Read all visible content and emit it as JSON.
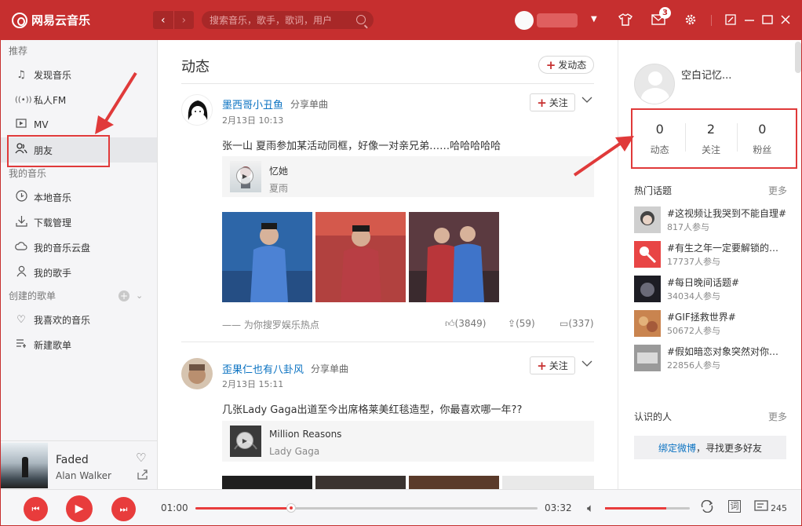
{
  "titlebar": {
    "app_name": "网易云音乐",
    "back_icon": "chevron-left",
    "forward_icon": "chevron-right",
    "search_placeholder": "搜索音乐，歌手，歌词，用户",
    "mail_badge": "3"
  },
  "sidebar": {
    "section_recommend": "推荐",
    "recommend_items": [
      {
        "icon": "music-note-icon",
        "label": "发现音乐"
      },
      {
        "icon": "radio-icon",
        "label": "私人FM"
      },
      {
        "icon": "mv-icon",
        "label": "MV"
      },
      {
        "icon": "friends-icon",
        "label": "朋友"
      }
    ],
    "section_my_music": "我的音乐",
    "my_music_items": [
      {
        "icon": "local-music-icon",
        "label": "本地音乐"
      },
      {
        "icon": "download-icon",
        "label": "下载管理"
      },
      {
        "icon": "cloud-icon",
        "label": "我的音乐云盘"
      },
      {
        "icon": "singer-icon",
        "label": "我的歌手"
      }
    ],
    "section_playlists": "创建的歌单",
    "playlist_items": [
      {
        "icon": "heart-icon",
        "label": "我喜欢的音乐"
      },
      {
        "icon": "new-playlist-icon",
        "label": "新建歌单"
      }
    ]
  },
  "now_playing": {
    "title": "Faded",
    "artist": "Alan Walker"
  },
  "player": {
    "current_time": "01:00",
    "total_time": "03:32",
    "progress": 0.28,
    "volume": 0.72,
    "lyrics_label": "词",
    "playlist_count": "245"
  },
  "main": {
    "title": "动态",
    "post_button": "发动态",
    "posts": [
      {
        "user": "墨西哥小丑鱼",
        "action": "分享单曲",
        "date": "2月13日 10:13",
        "follow": "关注",
        "text": "张一山 夏雨参加某活动同框，好像一对亲兄弟……哈哈哈哈哈",
        "song_title": "忆她",
        "song_artist": "夏雨",
        "source": "—— 为你搜罗娱乐热点",
        "likes": "(3849)",
        "shares": "(59)",
        "comments": "(337)"
      },
      {
        "user": "歪果仁也有八卦风",
        "action": "分享单曲",
        "date": "2月13日 15:11",
        "follow": "关注",
        "text": "几张Lady Gaga出道至今出席格莱美红毯造型，你最喜欢哪一年??",
        "song_title": "Million Reasons",
        "song_artist": "Lady Gaga"
      }
    ]
  },
  "right": {
    "user_name": "空白记忆...",
    "stats": [
      {
        "value": "0",
        "label": "动态"
      },
      {
        "value": "2",
        "label": "关注"
      },
      {
        "value": "0",
        "label": "粉丝"
      }
    ],
    "hot_topics_title": "热门话题",
    "more": "更多",
    "topics": [
      {
        "title": "#这视频让我哭到不能自理#",
        "count": "817人参与"
      },
      {
        "title": "#有生之年一定要解锁的…",
        "count": "17737人参与"
      },
      {
        "title": "#每日晚间话题#",
        "count": "34034人参与"
      },
      {
        "title": "#GIF拯救世界#",
        "count": "50672人参与"
      },
      {
        "title": "#假如暗恋对象突然对你…",
        "count": "22856人参与"
      }
    ],
    "known_people_title": "认识的人",
    "bind_link": "绑定微博",
    "bind_text": "，寻找更多好友"
  },
  "colors": {
    "brand_red": "#c62f2f",
    "accent_red": "#e83c3c",
    "link_blue": "#0c73c2",
    "annotation_red": "#e03a3a"
  }
}
